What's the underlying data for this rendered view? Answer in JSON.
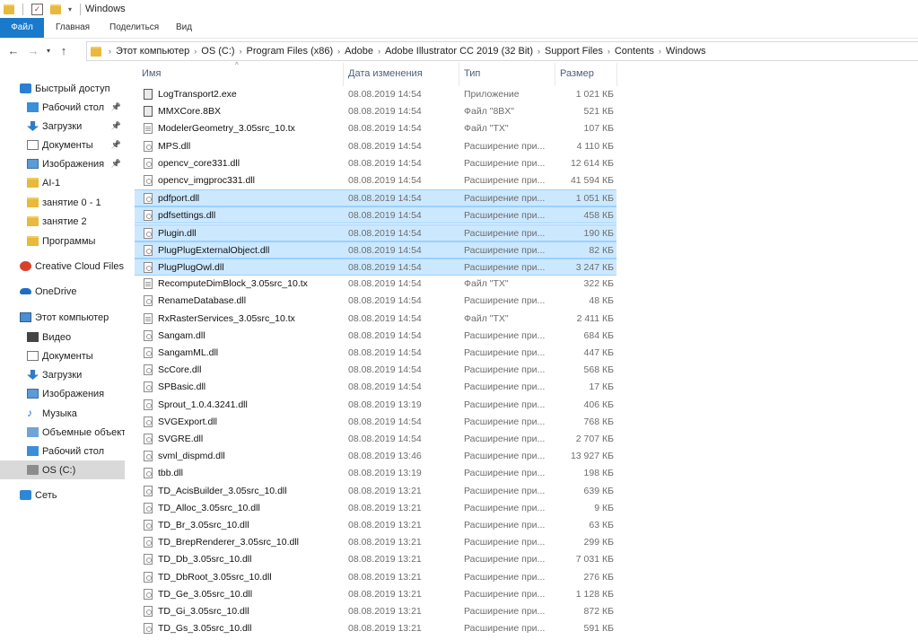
{
  "window": {
    "title": "Windows"
  },
  "ribbon": {
    "tabs": [
      "Файл",
      "Главная",
      "Поделиться",
      "Вид"
    ]
  },
  "address": {
    "crumbs": [
      "Этот компьютер",
      "OS (C:)",
      "Program Files (x86)",
      "Adobe",
      "Adobe Illustrator CC 2019 (32 Bit)",
      "Support Files",
      "Contents",
      "Windows"
    ]
  },
  "sidebar": {
    "items": [
      {
        "label": "Быстрый доступ",
        "icon": "star-icon",
        "pinned": false,
        "selected": false
      },
      {
        "label": "Рабочий стол",
        "icon": "desktop-icon",
        "pinned": true,
        "selected": false
      },
      {
        "label": "Загрузки",
        "icon": "download-icon",
        "pinned": true,
        "selected": false
      },
      {
        "label": "Документы",
        "icon": "documents-icon",
        "pinned": true,
        "selected": false
      },
      {
        "label": "Изображения",
        "icon": "pictures-icon",
        "pinned": true,
        "selected": false
      },
      {
        "label": "AI-1",
        "icon": "folder-icon",
        "pinned": false,
        "selected": false
      },
      {
        "label": "занятие 0 - 1",
        "icon": "folder-icon",
        "pinned": false,
        "selected": false
      },
      {
        "label": "занятие 2",
        "icon": "folder-icon",
        "pinned": false,
        "selected": false
      },
      {
        "label": "Программы",
        "icon": "folder-icon",
        "pinned": false,
        "selected": false
      },
      {
        "label": "Creative Cloud Files",
        "icon": "creative-cloud-icon",
        "pinned": false,
        "selected": false
      },
      {
        "label": "OneDrive",
        "icon": "onedrive-icon",
        "pinned": false,
        "selected": false
      },
      {
        "label": "Этот компьютер",
        "icon": "computer-icon",
        "pinned": false,
        "selected": false
      },
      {
        "label": "Видео",
        "icon": "video-icon",
        "pinned": false,
        "selected": false
      },
      {
        "label": "Документы",
        "icon": "documents-icon",
        "pinned": false,
        "selected": false
      },
      {
        "label": "Загрузки",
        "icon": "download-icon",
        "pinned": false,
        "selected": false
      },
      {
        "label": "Изображения",
        "icon": "pictures-icon",
        "pinned": false,
        "selected": false
      },
      {
        "label": "Музыка",
        "icon": "music-icon",
        "pinned": false,
        "selected": false
      },
      {
        "label": "Объемные объекты",
        "icon": "3d-objects-icon",
        "pinned": false,
        "selected": false
      },
      {
        "label": "Рабочий стол",
        "icon": "desktop-icon",
        "pinned": false,
        "selected": false
      },
      {
        "label": "OS (C:)",
        "icon": "drive-icon",
        "pinned": false,
        "selected": true
      },
      {
        "label": "Сеть",
        "icon": "network-icon",
        "pinned": false,
        "selected": false
      }
    ]
  },
  "columns": {
    "name": "Имя",
    "date": "Дата изменения",
    "type": "Тип",
    "size": "Размер"
  },
  "files": [
    {
      "name": "LogTransport2.exe",
      "date": "08.08.2019 14:54",
      "type": "Приложение",
      "size": "1 021 КБ",
      "kind": "exe",
      "selected": false
    },
    {
      "name": "MMXCore.8BX",
      "date": "08.08.2019 14:54",
      "type": "Файл \"8BX\"",
      "size": "521 КБ",
      "kind": "exe",
      "selected": false
    },
    {
      "name": "ModelerGeometry_3.05src_10.tx",
      "date": "08.08.2019 14:54",
      "type": "Файл \"TX\"",
      "size": "107 КБ",
      "kind": "txt",
      "selected": false
    },
    {
      "name": "MPS.dll",
      "date": "08.08.2019 14:54",
      "type": "Расширение при...",
      "size": "4 110 КБ",
      "kind": "dll",
      "selected": false
    },
    {
      "name": "opencv_core331.dll",
      "date": "08.08.2019 14:54",
      "type": "Расширение при...",
      "size": "12 614 КБ",
      "kind": "dll",
      "selected": false
    },
    {
      "name": "opencv_imgproc331.dll",
      "date": "08.08.2019 14:54",
      "type": "Расширение при...",
      "size": "41 594 КБ",
      "kind": "dll",
      "selected": false
    },
    {
      "name": "pdfport.dll",
      "date": "08.08.2019 14:54",
      "type": "Расширение при...",
      "size": "1 051 КБ",
      "kind": "dll",
      "selected": true
    },
    {
      "name": "pdfsettings.dll",
      "date": "08.08.2019 14:54",
      "type": "Расширение при...",
      "size": "458 КБ",
      "kind": "dll",
      "selected": true
    },
    {
      "name": "Plugin.dll",
      "date": "08.08.2019 14:54",
      "type": "Расширение при...",
      "size": "190 КБ",
      "kind": "dll",
      "selected": true
    },
    {
      "name": "PlugPlugExternalObject.dll",
      "date": "08.08.2019 14:54",
      "type": "Расширение при...",
      "size": "82 КБ",
      "kind": "dll",
      "selected": true
    },
    {
      "name": "PlugPlugOwl.dll",
      "date": "08.08.2019 14:54",
      "type": "Расширение при...",
      "size": "3 247 КБ",
      "kind": "dll",
      "selected": true
    },
    {
      "name": "RecomputeDimBlock_3.05src_10.tx",
      "date": "08.08.2019 14:54",
      "type": "Файл \"TX\"",
      "size": "322 КБ",
      "kind": "txt",
      "selected": false
    },
    {
      "name": "RenameDatabase.dll",
      "date": "08.08.2019 14:54",
      "type": "Расширение при...",
      "size": "48 КБ",
      "kind": "dll",
      "selected": false
    },
    {
      "name": "RxRasterServices_3.05src_10.tx",
      "date": "08.08.2019 14:54",
      "type": "Файл \"TX\"",
      "size": "2 411 КБ",
      "kind": "txt",
      "selected": false
    },
    {
      "name": "Sangam.dll",
      "date": "08.08.2019 14:54",
      "type": "Расширение при...",
      "size": "684 КБ",
      "kind": "dll",
      "selected": false
    },
    {
      "name": "SangamML.dll",
      "date": "08.08.2019 14:54",
      "type": "Расширение при...",
      "size": "447 КБ",
      "kind": "dll",
      "selected": false
    },
    {
      "name": "ScCore.dll",
      "date": "08.08.2019 14:54",
      "type": "Расширение при...",
      "size": "568 КБ",
      "kind": "dll",
      "selected": false
    },
    {
      "name": "SPBasic.dll",
      "date": "08.08.2019 14:54",
      "type": "Расширение при...",
      "size": "17 КБ",
      "kind": "dll",
      "selected": false
    },
    {
      "name": "Sprout_1.0.4.3241.dll",
      "date": "08.08.2019 13:19",
      "type": "Расширение при...",
      "size": "406 КБ",
      "kind": "dll",
      "selected": false
    },
    {
      "name": "SVGExport.dll",
      "date": "08.08.2019 14:54",
      "type": "Расширение при...",
      "size": "768 КБ",
      "kind": "dll",
      "selected": false
    },
    {
      "name": "SVGRE.dll",
      "date": "08.08.2019 14:54",
      "type": "Расширение при...",
      "size": "2 707 КБ",
      "kind": "dll",
      "selected": false
    },
    {
      "name": "svml_dispmd.dll",
      "date": "08.08.2019 13:46",
      "type": "Расширение при...",
      "size": "13 927 КБ",
      "kind": "dll",
      "selected": false
    },
    {
      "name": "tbb.dll",
      "date": "08.08.2019 13:19",
      "type": "Расширение при...",
      "size": "198 КБ",
      "kind": "dll",
      "selected": false
    },
    {
      "name": "TD_AcisBuilder_3.05src_10.dll",
      "date": "08.08.2019 13:21",
      "type": "Расширение при...",
      "size": "639 КБ",
      "kind": "dll",
      "selected": false
    },
    {
      "name": "TD_Alloc_3.05src_10.dll",
      "date": "08.08.2019 13:21",
      "type": "Расширение при...",
      "size": "9 КБ",
      "kind": "dll",
      "selected": false
    },
    {
      "name": "TD_Br_3.05src_10.dll",
      "date": "08.08.2019 13:21",
      "type": "Расширение при...",
      "size": "63 КБ",
      "kind": "dll",
      "selected": false
    },
    {
      "name": "TD_BrepRenderer_3.05src_10.dll",
      "date": "08.08.2019 13:21",
      "type": "Расширение при...",
      "size": "299 КБ",
      "kind": "dll",
      "selected": false
    },
    {
      "name": "TD_Db_3.05src_10.dll",
      "date": "08.08.2019 13:21",
      "type": "Расширение при...",
      "size": "7 031 КБ",
      "kind": "dll",
      "selected": false
    },
    {
      "name": "TD_DbRoot_3.05src_10.dll",
      "date": "08.08.2019 13:21",
      "type": "Расширение при...",
      "size": "276 КБ",
      "kind": "dll",
      "selected": false
    },
    {
      "name": "TD_Ge_3.05src_10.dll",
      "date": "08.08.2019 13:21",
      "type": "Расширение при...",
      "size": "1 128 КБ",
      "kind": "dll",
      "selected": false
    },
    {
      "name": "TD_Gi_3.05src_10.dll",
      "date": "08.08.2019 13:21",
      "type": "Расширение при...",
      "size": "872 КБ",
      "kind": "dll",
      "selected": false
    },
    {
      "name": "TD_Gs_3.05src_10.dll",
      "date": "08.08.2019 13:21",
      "type": "Расширение при...",
      "size": "591 КБ",
      "kind": "dll",
      "selected": false
    }
  ]
}
